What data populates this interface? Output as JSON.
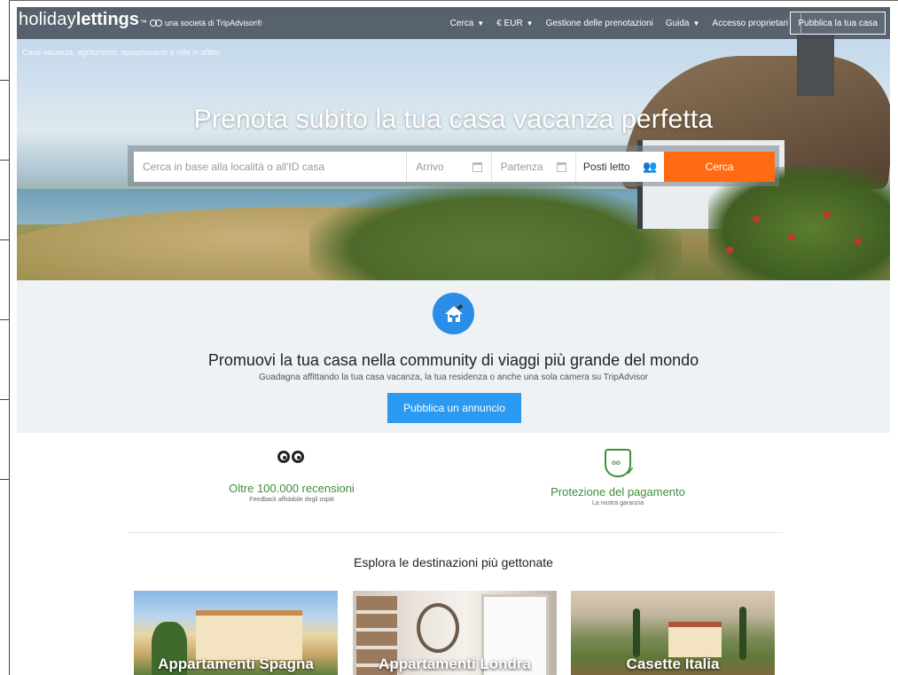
{
  "nav": {
    "logo_part1": "holiday",
    "logo_part2": "lettings",
    "logo_tm": "™",
    "logo_subtitle": "una società di TripAdvisor®",
    "links": [
      {
        "label": "Cerca",
        "has_chevron": true
      },
      {
        "label": "€ EUR",
        "has_chevron": true
      },
      {
        "label": "Gestione delle prenotazioni",
        "has_chevron": false
      },
      {
        "label": "Guida",
        "has_chevron": true
      },
      {
        "label": "Accesso proprietari",
        "has_chevron": false
      }
    ],
    "publish_label": "Pubblica la tua casa"
  },
  "hero": {
    "tagline": "Case vacanza, agriturismo, appartamenti e ville in affitto",
    "title": "Prenota subito la tua casa vacanza perfetta"
  },
  "search": {
    "where_placeholder": "Cerca in base alla località o all'ID casa",
    "checkin_placeholder": "Arrivo",
    "checkout_placeholder": "Partenza",
    "guests_label": "Posti letto",
    "submit_label": "Cerca"
  },
  "promo": {
    "title": "Promuovi la tua casa nella community di viaggi più grande del mondo",
    "subtitle": "Guadagna affittando la tua casa vacanza, la tua residenza o anche una sola camera su TripAdvisor",
    "button_label": "Pubblica un annuncio"
  },
  "features": [
    {
      "icon": "owl-icon",
      "title": "Oltre 100.000 recensioni",
      "subtitle": "Feedback affidabile degli ospiti"
    },
    {
      "icon": "shield-icon",
      "title": "Protezione del pagamento",
      "subtitle": "La nostra garanzia"
    }
  ],
  "destinations": {
    "title": "Esplora le destinazioni più gettonate",
    "cards": [
      {
        "label": "Appartamenti Spagna"
      },
      {
        "label": "Appartamenti Londra"
      },
      {
        "label": "Casette Italia"
      }
    ]
  },
  "colors": {
    "accent_orange": "#ff6a13",
    "accent_blue": "#2b9af3",
    "feature_green": "#3e8e3e",
    "nav_bg": "#404852"
  }
}
